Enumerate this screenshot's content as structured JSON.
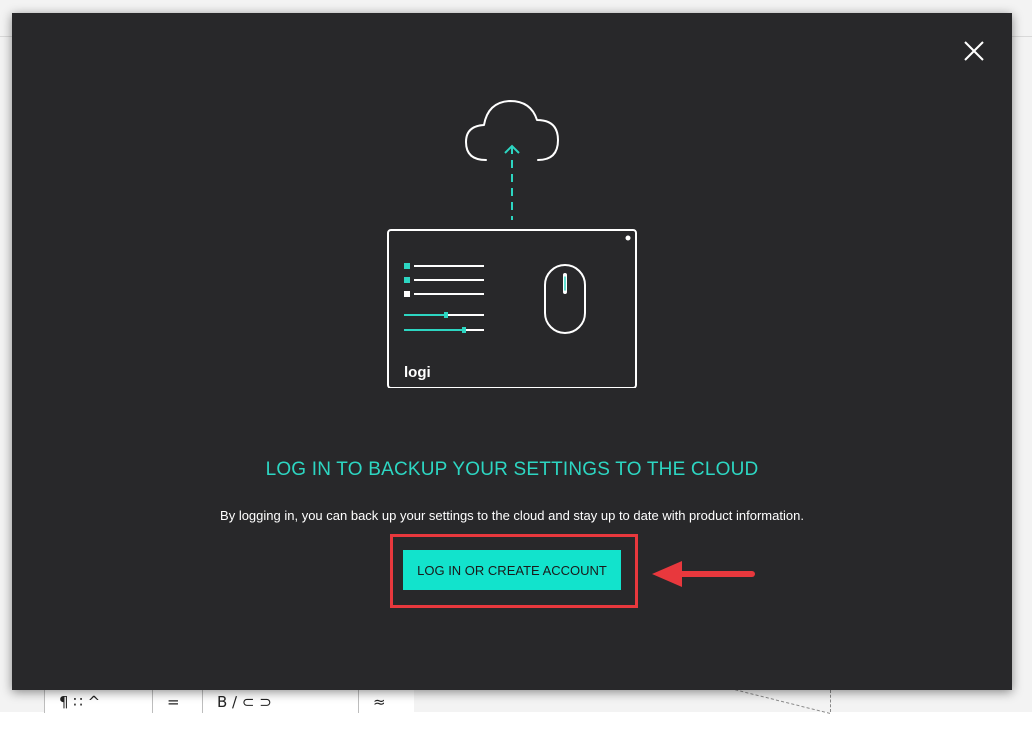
{
  "dialog": {
    "title": "LOG IN TO BACKUP YOUR SETTINGS TO THE CLOUD",
    "subtitle": "By logging in, you can back up your settings to the cloud and stay up to date with product information.",
    "login_button_label": "LOG IN OR CREATE ACCOUNT",
    "brand_logo_text": "logi"
  },
  "background_toolbar": {
    "items": [
      "¶ ∷ ^",
      "=",
      "B ∕ ⊂ ⊃",
      "≈"
    ]
  },
  "colors": {
    "accent": "#12e3cc",
    "title_text": "#2dd6c2",
    "dialog_bg": "#28282a",
    "highlight": "#e8383d"
  },
  "icons": {
    "close": "close-icon",
    "cloud": "cloud-upload-icon",
    "mouse": "mouse-icon",
    "arrow": "annotation-arrow-icon"
  }
}
